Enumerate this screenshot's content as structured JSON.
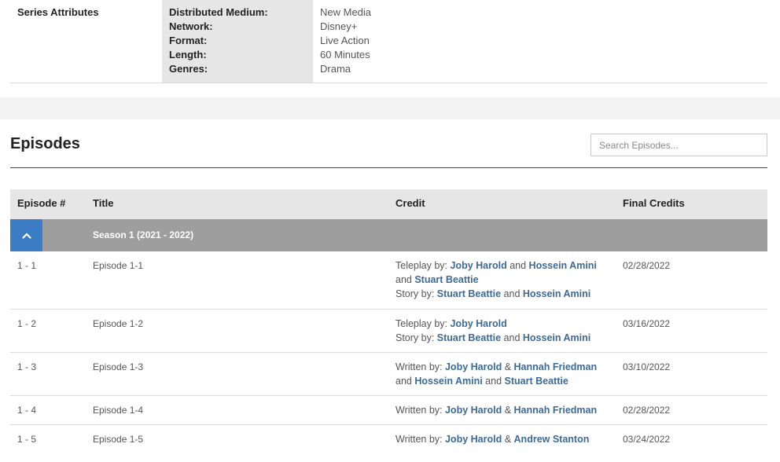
{
  "series_attributes": {
    "section_title": "Series Attributes",
    "rows": [
      {
        "label": "Distributed Medium:",
        "value": "New Media"
      },
      {
        "label": "Network:",
        "value": "Disney+"
      },
      {
        "label": "Format:",
        "value": "Live Action"
      },
      {
        "label": "Length:",
        "value": "60 Minutes"
      },
      {
        "label": "Genres:",
        "value": "Drama"
      }
    ]
  },
  "episodes": {
    "title": "Episodes",
    "search_placeholder": "Search Episodes...",
    "columns": {
      "number": "Episode #",
      "title": "Title",
      "credit": "Credit",
      "final": "Final Credits"
    },
    "season_label": "Season 1 (2021 - 2022)",
    "rows": [
      {
        "number": "1 - 1",
        "title": "Episode 1-1",
        "final": "02/28/2022",
        "credit": {
          "l1_prefix": "Teleplay by: ",
          "l1_n1": "Joby Harold",
          "l1_sep1": " and ",
          "l1_n2": "Hossein Amini",
          "l2_sep": "and ",
          "l2_n1": "Stuart Beattie",
          "l3_prefix": "Story by: ",
          "l3_n1": "Stuart Beattie",
          "l3_sep": " and ",
          "l3_n2": "Hossein Amini"
        }
      },
      {
        "number": "1 - 2",
        "title": "Episode 1-2",
        "final": "03/16/2022",
        "credit": {
          "l1_prefix": "Teleplay by: ",
          "l1_n1": "Joby Harold",
          "l2_prefix": "Story by: ",
          "l2_n1": "Stuart Beattie",
          "l2_sep": " and ",
          "l2_n2": "Hossein Amini"
        }
      },
      {
        "number": "1 - 3",
        "title": "Episode 1-3",
        "final": "03/10/2022",
        "credit": {
          "l1_prefix": "Written by: ",
          "l1_n1": "Joby Harold",
          "l1_sep": " & ",
          "l1_n2": "Hannah Friedman",
          "l2_sep1": "and ",
          "l2_n1": "Hossein Amini",
          "l2_sep2": " and ",
          "l2_n2": "Stuart Beattie"
        }
      },
      {
        "number": "1 - 4",
        "title": "Episode 1-4",
        "final": "02/28/2022",
        "credit": {
          "l1_prefix": "Written by: ",
          "l1_n1": "Joby Harold",
          "l1_sep": " & ",
          "l1_n2": "Hannah Friedman"
        }
      },
      {
        "number": "1 - 5",
        "title": "Episode 1-5",
        "final": "03/24/2022",
        "credit": {
          "l1_prefix": "Written by: ",
          "l1_n1": "Joby Harold",
          "l1_sep": " & ",
          "l1_n2": "Andrew Stanton"
        }
      }
    ]
  },
  "colors": {
    "accent": "#3b7dc4",
    "link": "#3b6a9a",
    "season_bar": "#9e9e9e",
    "header_bg": "#e6e6e6"
  },
  "icons": {
    "season_toggle": "chevron-up-icon"
  }
}
